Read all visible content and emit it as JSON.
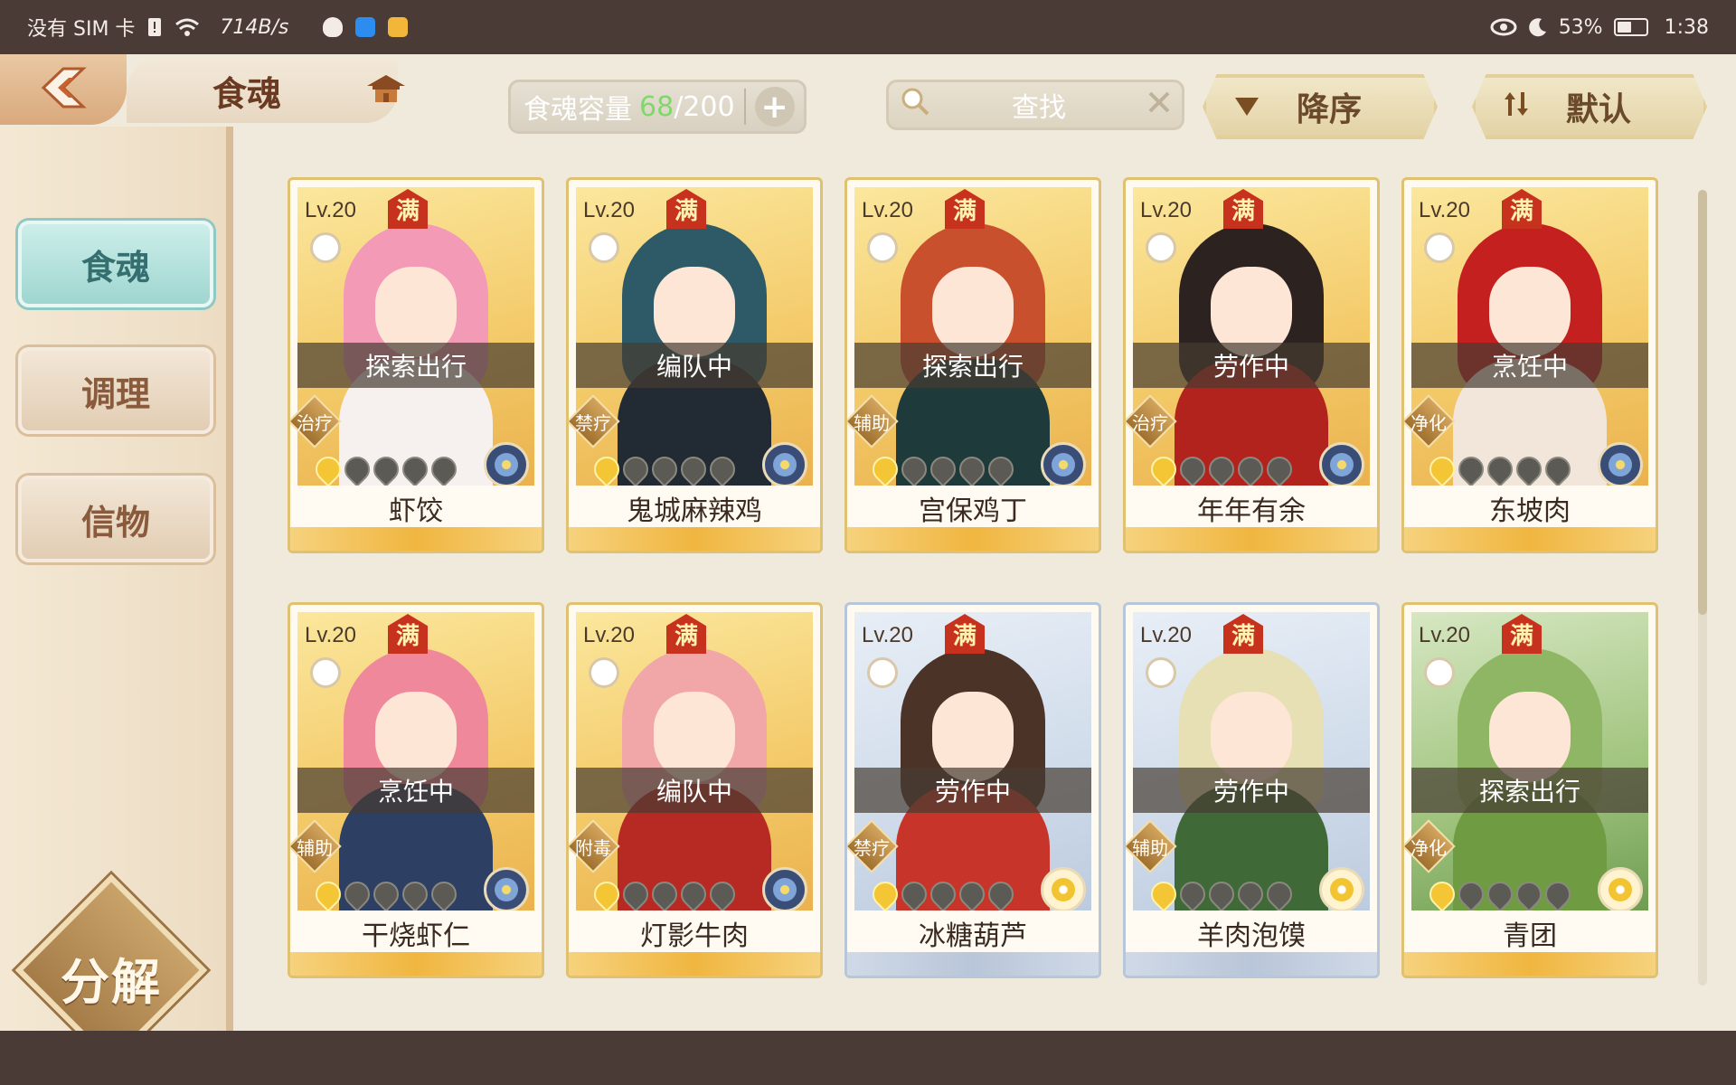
{
  "status_bar": {
    "carrier": "没有 SIM 卡",
    "speed": "714B/s",
    "battery": "53%",
    "battery_fraction": 0.53,
    "time": "1:38"
  },
  "header": {
    "title": "食魂",
    "capacity_label": "食魂容量",
    "capacity_current": "68",
    "capacity_max": "/200",
    "search_placeholder": "查找",
    "sort_order": "降序",
    "sort_mode": "默认"
  },
  "sidebar": {
    "items": [
      {
        "label": "食魂",
        "active": true
      },
      {
        "label": "调理",
        "active": false
      },
      {
        "label": "信物",
        "active": false
      }
    ],
    "decompose": "分解"
  },
  "cards": [
    {
      "level": "Lv.20",
      "max": "满",
      "status": "探索出行",
      "type": "治疗",
      "name": "虾饺",
      "stars": 1,
      "theme": "gold",
      "element": "dark",
      "colors": {
        "hair": "#f29ab6",
        "body": "#f6f1ee"
      }
    },
    {
      "level": "Lv.20",
      "max": "满",
      "status": "编队中",
      "type": "禁疗",
      "name": "鬼城麻辣鸡",
      "stars": 1,
      "theme": "gold",
      "element": "dark",
      "colors": {
        "hair": "#2d5a66",
        "body": "#222b33"
      }
    },
    {
      "level": "Lv.20",
      "max": "满",
      "status": "探索出行",
      "type": "辅助",
      "name": "宫保鸡丁",
      "stars": 1,
      "theme": "gold",
      "element": "dark",
      "colors": {
        "hair": "#c9502d",
        "body": "#1f3a3b"
      }
    },
    {
      "level": "Lv.20",
      "max": "满",
      "status": "劳作中",
      "type": "治疗",
      "name": "年年有余",
      "stars": 1,
      "theme": "gold",
      "element": "dark",
      "colors": {
        "hair": "#2c2220",
        "body": "#b3231d"
      }
    },
    {
      "level": "Lv.20",
      "max": "满",
      "status": "烹饪中",
      "type": "净化",
      "name": "东坡肉",
      "stars": 1,
      "theme": "gold",
      "element": "dark",
      "colors": {
        "hair": "#c4201f",
        "body": "#f2e6da"
      }
    },
    {
      "level": "Lv.20",
      "max": "满",
      "status": "烹饪中",
      "type": "辅助",
      "name": "干烧虾仁",
      "stars": 1,
      "theme": "gold",
      "element": "dark",
      "colors": {
        "hair": "#f0889c",
        "body": "#2d3f62"
      }
    },
    {
      "level": "Lv.20",
      "max": "满",
      "status": "编队中",
      "type": "附毒",
      "name": "灯影牛肉",
      "stars": 1,
      "theme": "gold",
      "element": "dark",
      "colors": {
        "hair": "#f1a6a8",
        "body": "#b72a24"
      }
    },
    {
      "level": "Lv.20",
      "max": "满",
      "status": "劳作中",
      "type": "禁疗",
      "name": "冰糖葫芦",
      "stars": 1,
      "theme": "blue",
      "element": "gold",
      "colors": {
        "hair": "#4b3328",
        "body": "#c7352a"
      }
    },
    {
      "level": "Lv.20",
      "max": "满",
      "status": "劳作中",
      "type": "辅助",
      "name": "羊肉泡馍",
      "stars": 1,
      "theme": "blue",
      "element": "gold",
      "colors": {
        "hair": "#e7e0b4",
        "body": "#3f6a38"
      }
    },
    {
      "level": "Lv.20",
      "max": "满",
      "status": "探索出行",
      "type": "净化",
      "name": "青团",
      "stars": 1,
      "theme": "green",
      "element": "gold",
      "colors": {
        "hair": "#8fb664",
        "body": "#6f9c43"
      }
    }
  ]
}
